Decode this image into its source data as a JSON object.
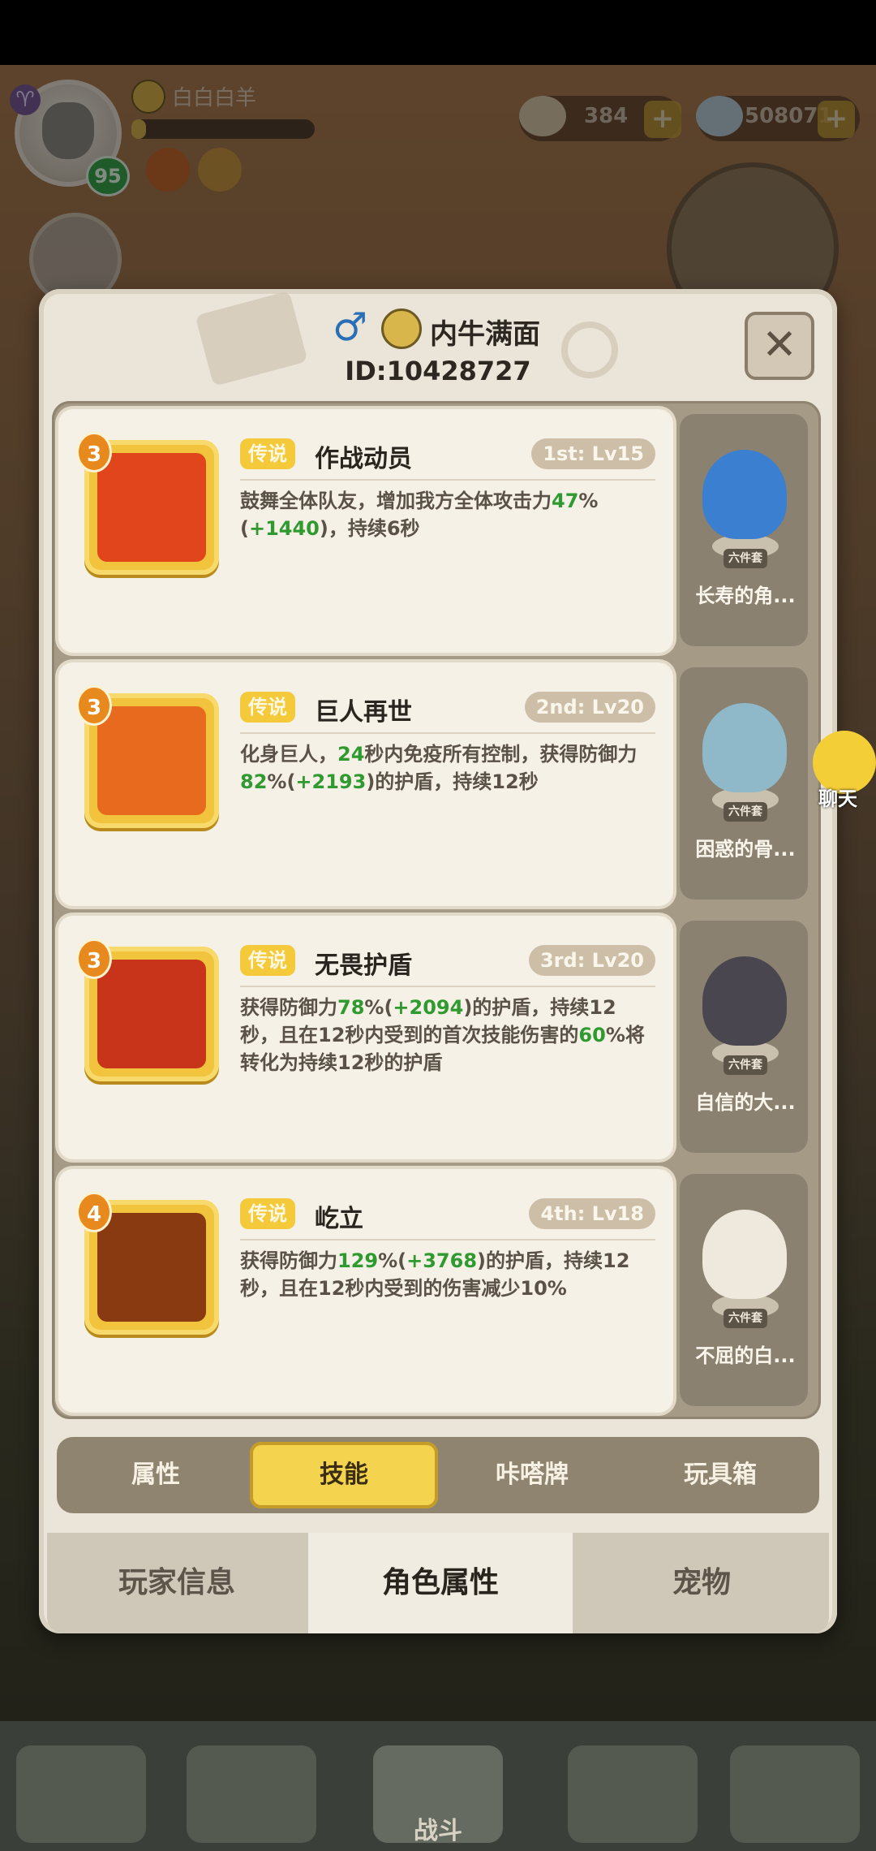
{
  "hud": {
    "player_name": "白白白羊",
    "level": "95",
    "currency_gem": "384",
    "currency_coin": "508071",
    "plus": "+"
  },
  "profile": {
    "name": "内牛满面",
    "id_text": "ID:10428727",
    "gender_symbol": "♂",
    "close_symbol": "✕"
  },
  "skills": [
    {
      "rank": "3",
      "quality": "传说",
      "name": "作战动员",
      "level_tag": "1st: Lv15",
      "desc_parts": [
        "鼓舞全体队友，增加我方全体攻击力",
        "47",
        "%(",
        "+1440",
        ")，持续6秒"
      ]
    },
    {
      "rank": "3",
      "quality": "传说",
      "name": "巨人再世",
      "level_tag": "2nd: Lv20",
      "desc_parts": [
        "化身巨人，",
        "24",
        "秒内免疫所有控制，获得防御力",
        "82",
        "%(",
        "+2193",
        ")的护盾，持续12秒"
      ]
    },
    {
      "rank": "3",
      "quality": "传说",
      "name": "无畏护盾",
      "level_tag": "3rd: Lv20",
      "desc_parts": [
        "获得防御力",
        "78",
        "%(",
        "+2094",
        ")的护盾，持续12秒，且在12秒内受到的首次技能伤害的",
        "60",
        "%将转化为持续12秒的护盾"
      ]
    },
    {
      "rank": "4",
      "quality": "传说",
      "name": "屹立",
      "level_tag": "4th: Lv18",
      "desc_parts": [
        "获得防御力",
        "129",
        "%(",
        "+3768",
        ")的护盾，持续12秒，且在12秒内受到的伤害减少10%"
      ]
    }
  ],
  "pets": [
    {
      "tag": "六件套",
      "name": "长寿的角...",
      "color": "#3b7fd0"
    },
    {
      "tag": "六件套",
      "name": "困惑的骨...",
      "color": "#8fb8c8"
    },
    {
      "tag": "六件套",
      "name": "自信的大...",
      "color": "#4a4650"
    },
    {
      "tag": "六件套",
      "name": "不屈的白...",
      "color": "#efe8dc"
    }
  ],
  "subtabs": [
    "属性",
    "技能",
    "咔嗒牌",
    "玩具箱"
  ],
  "active_subtab": "技能",
  "maintabs": [
    "玩家信息",
    "角色属性",
    "宠物"
  ],
  "active_maintab": "角色属性",
  "chat_label": "聊天",
  "bottom_nav": {
    "fight_label": "战斗"
  },
  "colors": {
    "highlight_green": "#2f9a2f",
    "legend_gold": "#f4c93a",
    "active_tab_yellow": "#f4d34f"
  }
}
